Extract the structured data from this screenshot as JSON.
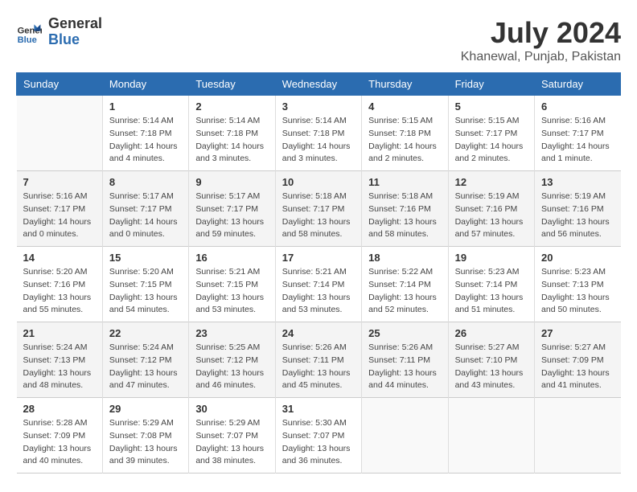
{
  "header": {
    "logo_line1": "General",
    "logo_line2": "Blue",
    "month": "July 2024",
    "location": "Khanewal, Punjab, Pakistan"
  },
  "days_of_week": [
    "Sunday",
    "Monday",
    "Tuesday",
    "Wednesday",
    "Thursday",
    "Friday",
    "Saturday"
  ],
  "weeks": [
    [
      {
        "day": "",
        "info": ""
      },
      {
        "day": "1",
        "info": "Sunrise: 5:14 AM\nSunset: 7:18 PM\nDaylight: 14 hours\nand 4 minutes."
      },
      {
        "day": "2",
        "info": "Sunrise: 5:14 AM\nSunset: 7:18 PM\nDaylight: 14 hours\nand 3 minutes."
      },
      {
        "day": "3",
        "info": "Sunrise: 5:14 AM\nSunset: 7:18 PM\nDaylight: 14 hours\nand 3 minutes."
      },
      {
        "day": "4",
        "info": "Sunrise: 5:15 AM\nSunset: 7:18 PM\nDaylight: 14 hours\nand 2 minutes."
      },
      {
        "day": "5",
        "info": "Sunrise: 5:15 AM\nSunset: 7:17 PM\nDaylight: 14 hours\nand 2 minutes."
      },
      {
        "day": "6",
        "info": "Sunrise: 5:16 AM\nSunset: 7:17 PM\nDaylight: 14 hours\nand 1 minute."
      }
    ],
    [
      {
        "day": "7",
        "info": "Sunrise: 5:16 AM\nSunset: 7:17 PM\nDaylight: 14 hours\nand 0 minutes."
      },
      {
        "day": "8",
        "info": "Sunrise: 5:17 AM\nSunset: 7:17 PM\nDaylight: 14 hours\nand 0 minutes."
      },
      {
        "day": "9",
        "info": "Sunrise: 5:17 AM\nSunset: 7:17 PM\nDaylight: 13 hours\nand 59 minutes."
      },
      {
        "day": "10",
        "info": "Sunrise: 5:18 AM\nSunset: 7:17 PM\nDaylight: 13 hours\nand 58 minutes."
      },
      {
        "day": "11",
        "info": "Sunrise: 5:18 AM\nSunset: 7:16 PM\nDaylight: 13 hours\nand 58 minutes."
      },
      {
        "day": "12",
        "info": "Sunrise: 5:19 AM\nSunset: 7:16 PM\nDaylight: 13 hours\nand 57 minutes."
      },
      {
        "day": "13",
        "info": "Sunrise: 5:19 AM\nSunset: 7:16 PM\nDaylight: 13 hours\nand 56 minutes."
      }
    ],
    [
      {
        "day": "14",
        "info": "Sunrise: 5:20 AM\nSunset: 7:16 PM\nDaylight: 13 hours\nand 55 minutes."
      },
      {
        "day": "15",
        "info": "Sunrise: 5:20 AM\nSunset: 7:15 PM\nDaylight: 13 hours\nand 54 minutes."
      },
      {
        "day": "16",
        "info": "Sunrise: 5:21 AM\nSunset: 7:15 PM\nDaylight: 13 hours\nand 53 minutes."
      },
      {
        "day": "17",
        "info": "Sunrise: 5:21 AM\nSunset: 7:14 PM\nDaylight: 13 hours\nand 53 minutes."
      },
      {
        "day": "18",
        "info": "Sunrise: 5:22 AM\nSunset: 7:14 PM\nDaylight: 13 hours\nand 52 minutes."
      },
      {
        "day": "19",
        "info": "Sunrise: 5:23 AM\nSunset: 7:14 PM\nDaylight: 13 hours\nand 51 minutes."
      },
      {
        "day": "20",
        "info": "Sunrise: 5:23 AM\nSunset: 7:13 PM\nDaylight: 13 hours\nand 50 minutes."
      }
    ],
    [
      {
        "day": "21",
        "info": "Sunrise: 5:24 AM\nSunset: 7:13 PM\nDaylight: 13 hours\nand 48 minutes."
      },
      {
        "day": "22",
        "info": "Sunrise: 5:24 AM\nSunset: 7:12 PM\nDaylight: 13 hours\nand 47 minutes."
      },
      {
        "day": "23",
        "info": "Sunrise: 5:25 AM\nSunset: 7:12 PM\nDaylight: 13 hours\nand 46 minutes."
      },
      {
        "day": "24",
        "info": "Sunrise: 5:26 AM\nSunset: 7:11 PM\nDaylight: 13 hours\nand 45 minutes."
      },
      {
        "day": "25",
        "info": "Sunrise: 5:26 AM\nSunset: 7:11 PM\nDaylight: 13 hours\nand 44 minutes."
      },
      {
        "day": "26",
        "info": "Sunrise: 5:27 AM\nSunset: 7:10 PM\nDaylight: 13 hours\nand 43 minutes."
      },
      {
        "day": "27",
        "info": "Sunrise: 5:27 AM\nSunset: 7:09 PM\nDaylight: 13 hours\nand 41 minutes."
      }
    ],
    [
      {
        "day": "28",
        "info": "Sunrise: 5:28 AM\nSunset: 7:09 PM\nDaylight: 13 hours\nand 40 minutes."
      },
      {
        "day": "29",
        "info": "Sunrise: 5:29 AM\nSunset: 7:08 PM\nDaylight: 13 hours\nand 39 minutes."
      },
      {
        "day": "30",
        "info": "Sunrise: 5:29 AM\nSunset: 7:07 PM\nDaylight: 13 hours\nand 38 minutes."
      },
      {
        "day": "31",
        "info": "Sunrise: 5:30 AM\nSunset: 7:07 PM\nDaylight: 13 hours\nand 36 minutes."
      },
      {
        "day": "",
        "info": ""
      },
      {
        "day": "",
        "info": ""
      },
      {
        "day": "",
        "info": ""
      }
    ]
  ]
}
